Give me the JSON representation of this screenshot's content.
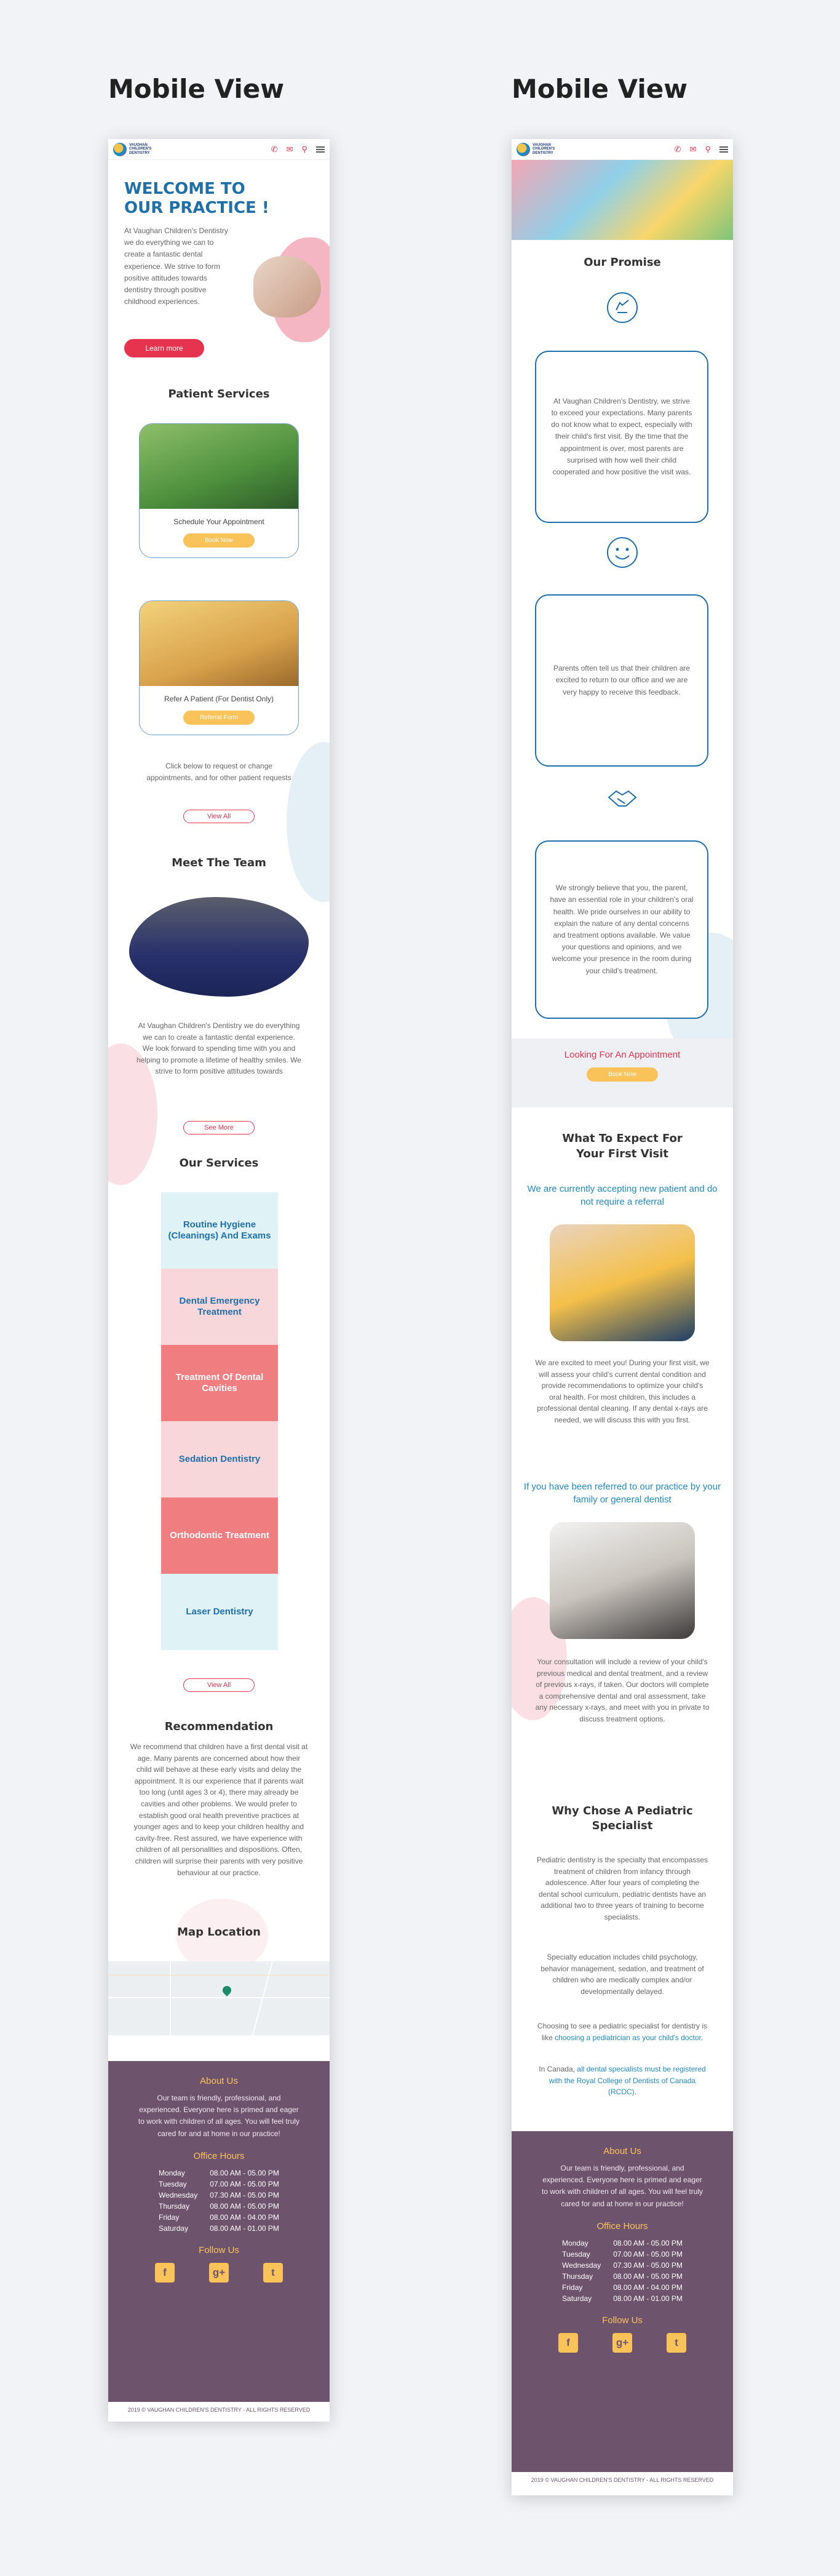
{
  "views": {
    "left_title": "Mobile View",
    "right_title": "Mobile View"
  },
  "brand": {
    "logo_text": "VAUGHAN CHILDREN'S DENTISTRY",
    "accent": "#e6334e",
    "blue": "#1f8ac1",
    "yellow": "#f9c35a",
    "footer_bg": "#6e536d"
  },
  "nav": {
    "icons": [
      "phone-icon",
      "mail-icon",
      "location-icon",
      "menu-icon"
    ]
  },
  "welcome": {
    "title": "WELCOME TO OUR PRACTICE !",
    "text": "At Vaughan Children's Dentistry we do everything we can to create a fantastic dental experience. We strive to form positive attitudes towards dentistry through positive childhood experiences.",
    "button": "Learn more"
  },
  "patient_services": {
    "title": "Patient Services",
    "cards": [
      {
        "label": "Schedule Your Appointment",
        "button": "Book Now"
      },
      {
        "label": "Refer A Patient (For Dentist Only)",
        "button": "Referral Form"
      }
    ],
    "note": "Click below to request or change appointments, and for other patient requests",
    "button": "View All"
  },
  "team": {
    "title": "Meet The Team",
    "text": "At Vaughan Children's Dentistry we do everything we can to create a fantastic dental experience. We look forward to spending time with you and helping to promote a lifetime of healthy smiles. We strive to form positive attitudes towards",
    "button": "See More"
  },
  "services": {
    "title": "Our Services",
    "items": [
      "Routine Hygiene (Cleanings) And Exams",
      "Dental Emergency Treatment",
      "Treatment Of Dental Cavities",
      "Sedation Dentistry",
      "Orthodontic Treatment",
      "Laser Dentistry"
    ],
    "button": "View All"
  },
  "recommendation": {
    "title": "Recommendation",
    "text": "We recommend that children have a first dental visit at age. Many parents are concerned about how their child will behave at these early visits and delay the appointment. It is our experience that if parents wait too long (until ages 3 or 4), there may already be cavities and other problems. We would prefer to establish good oral health preventive practices at younger ages and to keep your children healthy and cavity-free. Rest assured, we have experience with children of all personalities and dispositions. Often, children will surprise their parents with very positive behaviour at our practice."
  },
  "map": {
    "title": "Map Location"
  },
  "footer": {
    "about_title": "About Us",
    "about_text": "Our team is friendly, professional, and experienced. Everyone here is primed and eager to work with children of all ages. You will feel truly cared for and at home in our practice!",
    "hours_title": "Office Hours",
    "hours": [
      {
        "day": "Monday",
        "time": "08.00 AM - 05.00 PM"
      },
      {
        "day": "Tuesday",
        "time": "07.00 AM - 05.00 PM"
      },
      {
        "day": "Wednesday",
        "time": "07.30 AM - 05.00 PM"
      },
      {
        "day": "Thursday",
        "time": "08.00 AM - 05.00 PM"
      },
      {
        "day": "Friday",
        "time": "08.00 AM - 04.00 PM"
      },
      {
        "day": "Saturday",
        "time": "08.00 AM - 01.00 PM"
      }
    ],
    "follow_title": "Follow Us",
    "social": [
      "facebook-icon",
      "google-plus-icon",
      "twitter-icon"
    ],
    "copyright": "2019 © VAUGHAN CHILDREN'S DENTISTRY - ALL RIGHTS RESERVED"
  },
  "promise": {
    "title": "Our Promise",
    "items": [
      "At Vaughan Children's Dentistry, we strive to exceed your expectations. Many parents do not know what to expect, especially with their child's first visit. By the time that the appointment is over, most parents are surprised with how well their child cooperated and how positive the visit was.",
      "Parents often tell us that their children are excited to return to our office and we are very happy to receive this feedback.",
      "We strongly believe that you, the parent, have an essential role in your children's oral health. We pride ourselves in our ability to explain the nature of any dental concerns and treatment options available. We value your questions and opinions, and we welcome your presence in the room during your child's treatment."
    ]
  },
  "appointment": {
    "title": "Looking For An Appointment",
    "button": "Book Now"
  },
  "first_visit": {
    "title": "What To Expect For Your First Visit",
    "sub1": "We are currently accepting new patient and do not require a referral",
    "text1": "We are excited to meet you! During your first visit, we will assess your child's current dental condition and provide recommendations to optimize your child's oral health. For most children, this includes a professional dental cleaning. If any dental x-rays are needed, we will discuss this with you first.",
    "sub2": "If you have been referred to our practice by your family or general dentist",
    "text2": "Your consultation will include a review of your child's previous medical and dental treatment, and a review of previous x-rays, if taken. Our doctors will complete a comprehensive dental and oral assessment, take any necessary x-rays, and meet with you in private to discuss treatment options."
  },
  "why": {
    "title": "Why Chose A Pediatric Specialist",
    "p1": "Pediatric dentistry is the specialty that encompasses treatment of children from infancy through adolescence. After four years of completing the dental school curriculum, pediatric dentists have an additional two to three years of training to become specialists.",
    "p2": "Specialty education includes child psychology, behavior management, sedation, and treatment of children who are medically complex and/or developmentally delayed.",
    "p3a": "Choosing to see a pediatric specialist for dentistry is like ",
    "p3b": "choosing a pediatrician as your child's doctor.",
    "p4a": "In Canada, ",
    "p4b": "all dental specialists must be registered with the Royal College of Dentists of Canada (RCDC)."
  }
}
